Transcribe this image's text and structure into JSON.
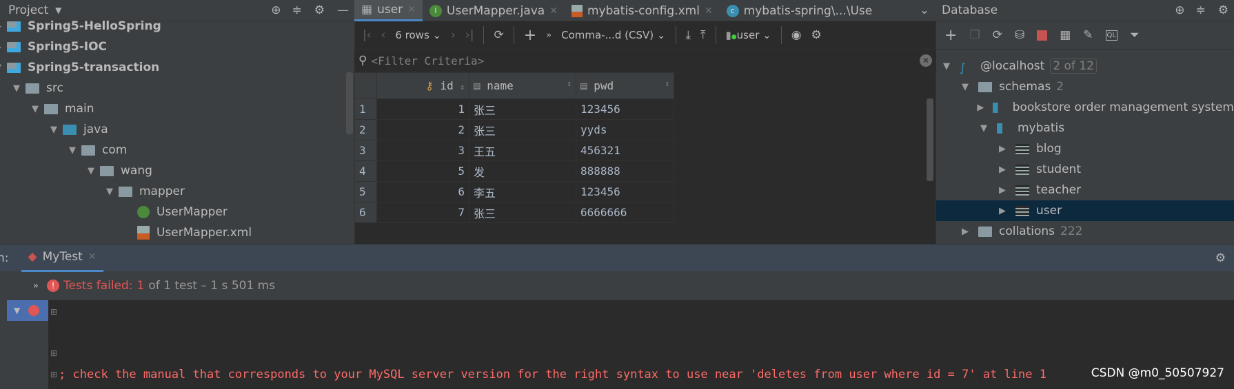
{
  "project": {
    "title": "Project",
    "items": [
      {
        "label": "Spring5-HelloSpring",
        "bold": true,
        "depth": 0,
        "open": false,
        "icon": "module"
      },
      {
        "label": "Spring5-IOC",
        "bold": true,
        "depth": 0,
        "open": false,
        "icon": "module"
      },
      {
        "label": "Spring5-transaction",
        "bold": true,
        "depth": 0,
        "open": true,
        "icon": "module"
      },
      {
        "label": "src",
        "depth": 1,
        "open": true,
        "icon": "folder"
      },
      {
        "label": "main",
        "depth": 2,
        "open": true,
        "icon": "folder"
      },
      {
        "label": "java",
        "depth": 3,
        "open": true,
        "icon": "source-folder"
      },
      {
        "label": "com",
        "depth": 4,
        "open": true,
        "icon": "package"
      },
      {
        "label": "wang",
        "depth": 5,
        "open": true,
        "icon": "package"
      },
      {
        "label": "mapper",
        "depth": 6,
        "open": true,
        "icon": "package"
      },
      {
        "label": "UserMapper",
        "depth": 7,
        "icon": "interface"
      },
      {
        "label": "UserMapper.xml",
        "depth": 7,
        "icon": "xml"
      }
    ]
  },
  "editor": {
    "tabs": [
      {
        "label": "user",
        "icon": "table",
        "active": true
      },
      {
        "label": "UserMapper.java",
        "icon": "interface"
      },
      {
        "label": "mybatis-config.xml",
        "icon": "xml"
      },
      {
        "label": "mybatis-spring\\...\\Use",
        "icon": "class"
      }
    ],
    "toolbar": {
      "rows": "6 rows",
      "format": "Comma-...d (CSV)",
      "schema": "user"
    },
    "filter_placeholder": "<Filter Criteria>",
    "columns": [
      "id",
      "name",
      "pwd"
    ],
    "rows": [
      [
        "1",
        "1",
        "张三",
        "123456"
      ],
      [
        "2",
        "2",
        "张三",
        "yyds"
      ],
      [
        "3",
        "3",
        "王五",
        "456321"
      ],
      [
        "4",
        "5",
        "发",
        "888888"
      ],
      [
        "5",
        "6",
        "李五",
        "123456"
      ],
      [
        "6",
        "7",
        "张三",
        "6666666"
      ]
    ]
  },
  "database": {
    "title": "Database",
    "items": [
      {
        "label": "@localhost",
        "count": "2 of 12",
        "depth": 0,
        "open": true,
        "icon": "mysql"
      },
      {
        "label": "schemas",
        "count": "2",
        "depth": 1,
        "open": true,
        "icon": "folder"
      },
      {
        "label": "bookstore order management system",
        "depth": 2,
        "open": false,
        "icon": "schema"
      },
      {
        "label": "mybatis",
        "depth": 2,
        "open": true,
        "icon": "schema"
      },
      {
        "label": "blog",
        "depth": 3,
        "open": false,
        "icon": "table"
      },
      {
        "label": "student",
        "depth": 3,
        "open": false,
        "icon": "table"
      },
      {
        "label": "teacher",
        "depth": 3,
        "open": false,
        "icon": "table"
      },
      {
        "label": "user",
        "depth": 3,
        "open": false,
        "icon": "table",
        "selected": true
      },
      {
        "label": "collations",
        "count": "222",
        "depth": 1,
        "open": false,
        "icon": "folder"
      }
    ]
  },
  "run": {
    "prefix": "n:",
    "tab": "MyTest",
    "status_failed": "Tests failed:",
    "failed_count": "1",
    "status_rest": "of 1 test – 1 s 501 ms",
    "console_line": "; check the manual that corresponds to your MySQL server version for the right syntax to use near 'deletes from user where id = 7' at line 1",
    "watermark": "CSDN @m0_50507927"
  },
  "colors": {
    "accent": "#4a88c7",
    "error": "#e05555",
    "selected": "#0d293e"
  }
}
